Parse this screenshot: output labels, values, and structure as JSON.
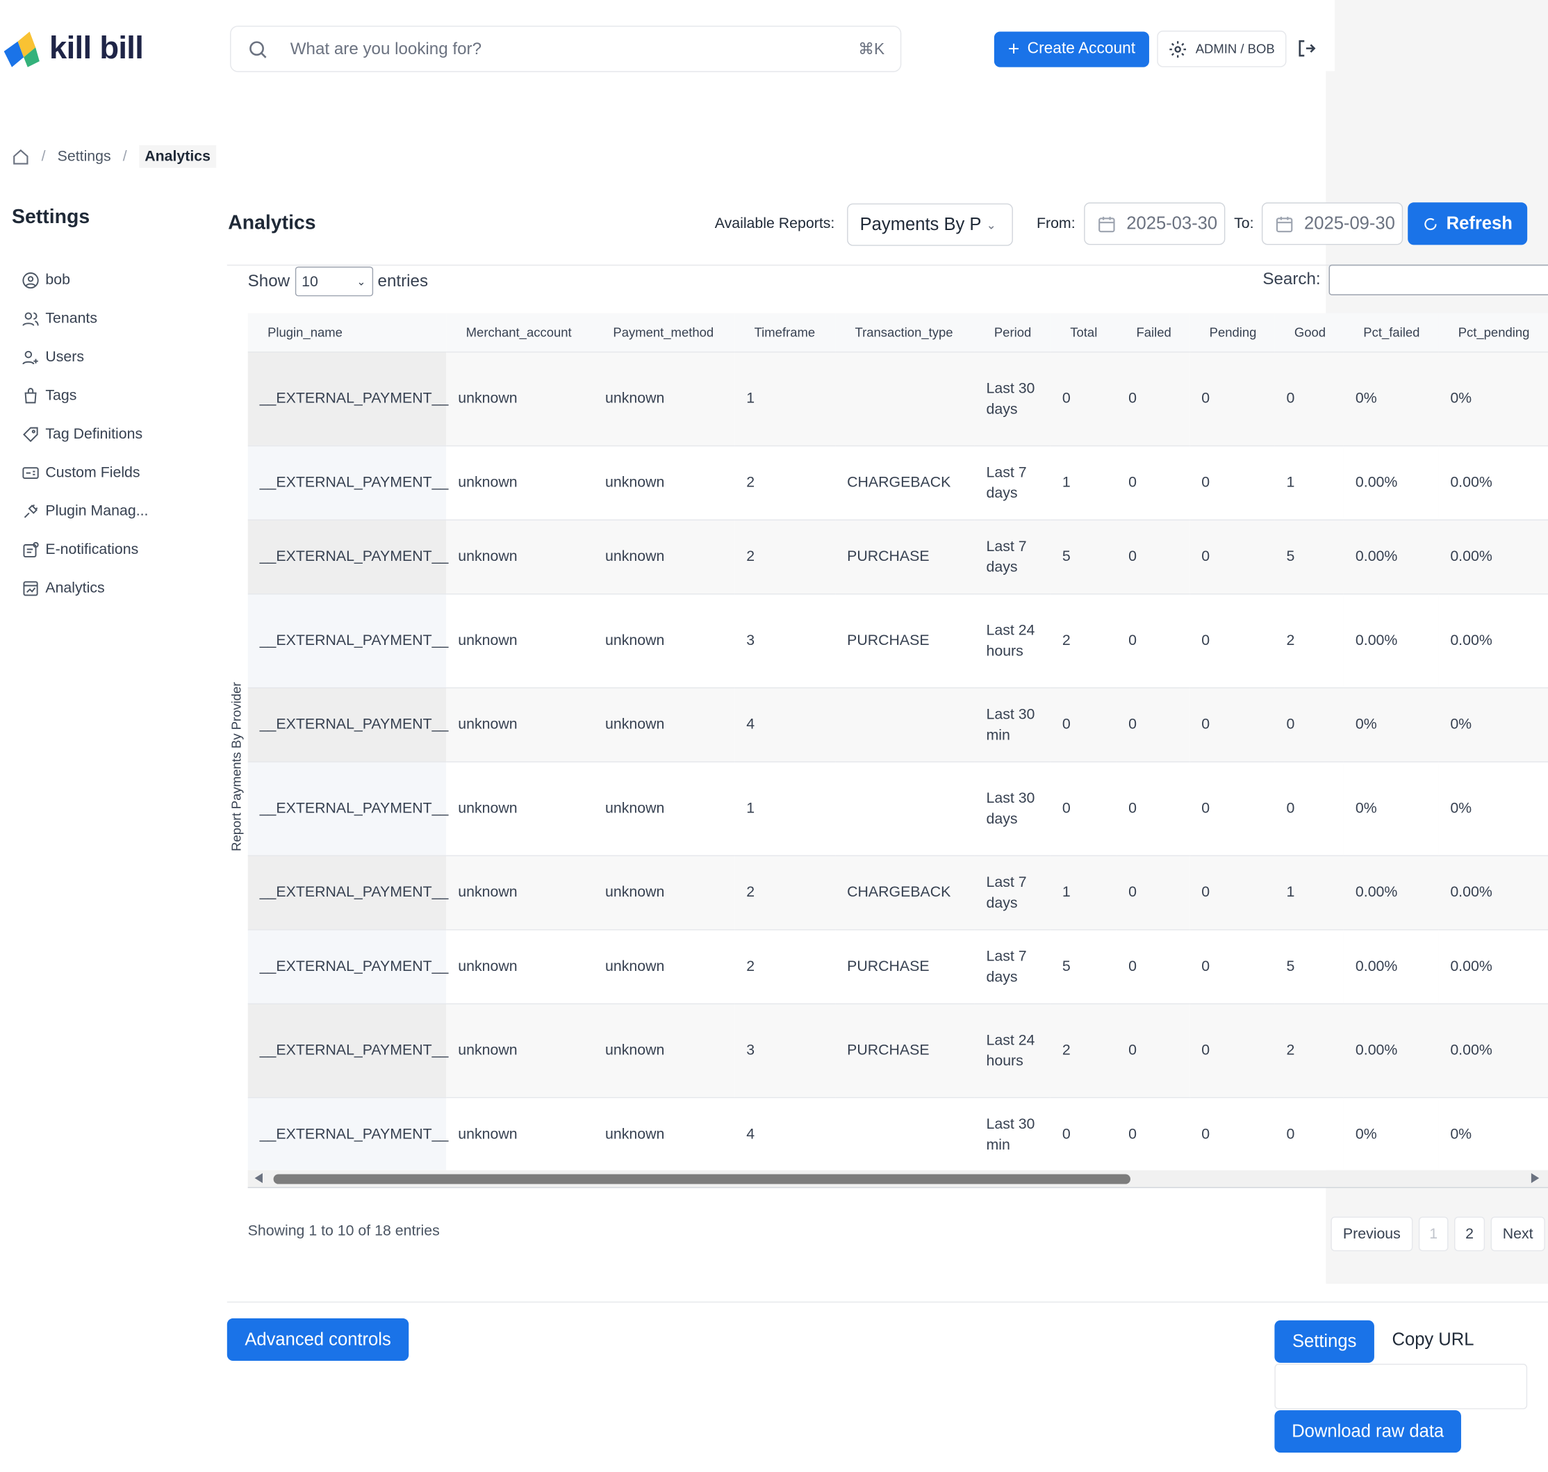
{
  "app": {
    "name": "kill bill"
  },
  "header": {
    "search_placeholder": "What are you looking for?",
    "search_shortcut": "⌘K",
    "create_account_label": "Create Account",
    "user_label": "ADMIN / BOB"
  },
  "breadcrumb": {
    "items": [
      "Settings",
      "Analytics"
    ]
  },
  "sidebar": {
    "title": "Settings",
    "items": [
      {
        "label": "bob",
        "icon": "user-circle-icon"
      },
      {
        "label": "Tenants",
        "icon": "users-icon"
      },
      {
        "label": "Users",
        "icon": "user-plus-icon"
      },
      {
        "label": "Tags",
        "icon": "shopping-bag-icon"
      },
      {
        "label": "Tag Definitions",
        "icon": "tag-icon"
      },
      {
        "label": "Custom Fields",
        "icon": "id-card-icon"
      },
      {
        "label": "Plugin Manag...",
        "icon": "plug-icon"
      },
      {
        "label": "E-notifications",
        "icon": "notification-icon"
      },
      {
        "label": "Analytics",
        "icon": "chart-icon"
      }
    ]
  },
  "main": {
    "title": "Analytics",
    "reports_label": "Available Reports:",
    "report_selected": "Payments By Provider",
    "from_label": "From:",
    "from_value": "2025-03-30",
    "to_label": "To:",
    "to_value": "2025-09-30",
    "refresh_label": "Refresh",
    "vertical_label": "Report Payments By Provider"
  },
  "table_controls": {
    "show_label": "Show",
    "page_length": "10",
    "entries_label": "entries",
    "search_label": "Search:",
    "info": "Showing 1 to 10 of 18 entries",
    "previous": "Previous",
    "pages": [
      "1",
      "2"
    ],
    "next": "Next"
  },
  "table": {
    "columns": [
      "Plugin_name",
      "Merchant_account",
      "Payment_method",
      "Timeframe",
      "Transaction_type",
      "Period",
      "Total",
      "Failed",
      "Pending",
      "Good",
      "Pct_failed",
      "Pct_pending"
    ],
    "rows": [
      [
        "__EXTERNAL_PAYMENT__",
        "unknown",
        "unknown",
        "1",
        "",
        "Last 30 days",
        "0",
        "0",
        "0",
        "0",
        "0%",
        "0%"
      ],
      [
        "__EXTERNAL_PAYMENT__",
        "unknown",
        "unknown",
        "2",
        "CHARGEBACK",
        "Last 7 days",
        "1",
        "0",
        "0",
        "1",
        "0.00%",
        "0.00%"
      ],
      [
        "__EXTERNAL_PAYMENT__",
        "unknown",
        "unknown",
        "2",
        "PURCHASE",
        "Last 7 days",
        "5",
        "0",
        "0",
        "5",
        "0.00%",
        "0.00%"
      ],
      [
        "__EXTERNAL_PAYMENT__",
        "unknown",
        "unknown",
        "3",
        "PURCHASE",
        "Last 24 hours",
        "2",
        "0",
        "0",
        "2",
        "0.00%",
        "0.00%"
      ],
      [
        "__EXTERNAL_PAYMENT__",
        "unknown",
        "unknown",
        "4",
        "",
        "Last 30 min",
        "0",
        "0",
        "0",
        "0",
        "0%",
        "0%"
      ],
      [
        "__EXTERNAL_PAYMENT__",
        "unknown",
        "unknown",
        "1",
        "",
        "Last 30 days",
        "0",
        "0",
        "0",
        "0",
        "0%",
        "0%"
      ],
      [
        "__EXTERNAL_PAYMENT__",
        "unknown",
        "unknown",
        "2",
        "CHARGEBACK",
        "Last 7 days",
        "1",
        "0",
        "0",
        "1",
        "0.00%",
        "0.00%"
      ],
      [
        "__EXTERNAL_PAYMENT__",
        "unknown",
        "unknown",
        "2",
        "PURCHASE",
        "Last 7 days",
        "5",
        "0",
        "0",
        "5",
        "0.00%",
        "0.00%"
      ],
      [
        "__EXTERNAL_PAYMENT__",
        "unknown",
        "unknown",
        "3",
        "PURCHASE",
        "Last 24 hours",
        "2",
        "0",
        "0",
        "2",
        "0.00%",
        "0.00%"
      ],
      [
        "__EXTERNAL_PAYMENT__",
        "unknown",
        "unknown",
        "4",
        "",
        "Last 30 min",
        "0",
        "0",
        "0",
        "0",
        "0%",
        "0%"
      ]
    ]
  },
  "footer": {
    "advanced_label": "Advanced controls",
    "settings_label": "Settings",
    "copy_url_label": "Copy URL",
    "download_label": "Download raw data"
  },
  "colors": {
    "primary": "#1a73e8",
    "text": "#1f2937",
    "muted": "#6b7280",
    "border": "#e5e7eb"
  }
}
